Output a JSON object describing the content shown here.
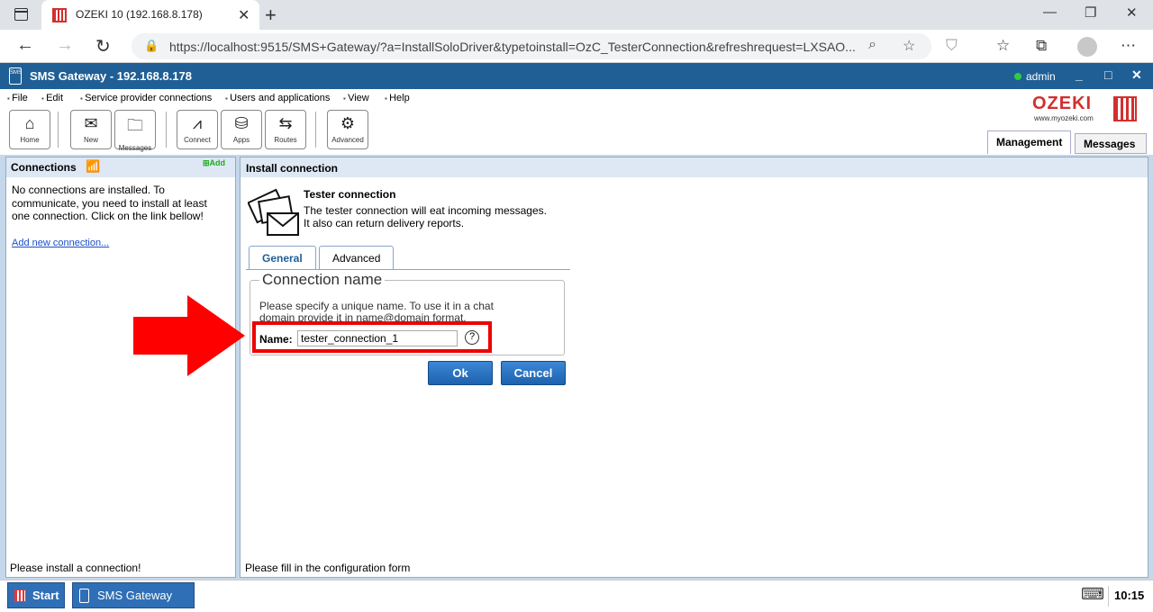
{
  "browser": {
    "tab_title": "OZEKI 10 (192.168.8.178)",
    "url": "https://localhost:9515/SMS+Gateway/?a=InstallSoloDriver&typetoinstall=OzC_TesterConnection&refreshrequest=LXSAO..."
  },
  "app": {
    "title": "SMS Gateway - 192.168.8.178",
    "user": "admin",
    "menu": [
      "File",
      "Edit",
      "Service provider connections",
      "Users and applications",
      "View",
      "Help"
    ],
    "toolbar": {
      "home": "Home",
      "new": "New",
      "messages": "Messages",
      "connect": "Connect",
      "apps": "Apps",
      "routes": "Routes",
      "advanced": "Advanced"
    },
    "logo": {
      "brand": "OZEKI",
      "site": "www.myozeki.com"
    },
    "right_tabs": {
      "management": "Management",
      "messages": "Messages"
    }
  },
  "left_panel": {
    "title": "Connections",
    "add_label": "Add",
    "message": "No connections are installed. To communicate, you need to install at least one connection. Click on the link bellow!",
    "link": "Add new connection...",
    "footer": "Please install a connection!"
  },
  "right_panel": {
    "title": "Install connection",
    "connection_title": "Tester connection",
    "connection_desc": "The tester connection will eat incoming messages. It also can return delivery reports.",
    "tabs": {
      "general": "General",
      "advanced": "Advanced"
    },
    "fieldset_legend": "Connection name",
    "fieldset_help": "Please specify a unique name. To use it in a chat domain provide it in name@domain format.",
    "name_label": "Name:",
    "name_value": "tester_connection_1",
    "help_icon": "?",
    "ok": "Ok",
    "cancel": "Cancel",
    "footer": "Please fill in the configuration form"
  },
  "taskbar": {
    "start": "Start",
    "app": "SMS Gateway",
    "time": "10:15"
  },
  "colors": {
    "title_bar": "#1f5f95",
    "accent_red": "#e00000",
    "panel_bg": "#c5d7ea"
  }
}
